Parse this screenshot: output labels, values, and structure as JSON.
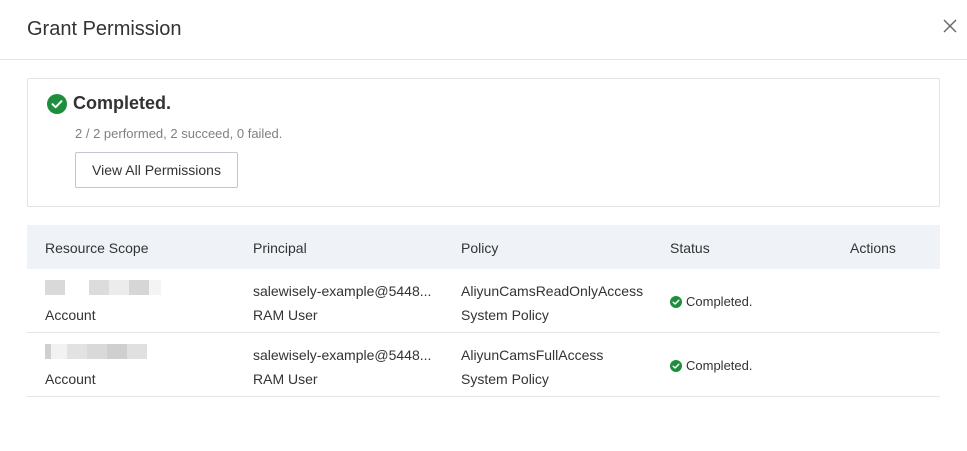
{
  "dialog": {
    "title": "Grant Permission",
    "close_icon": "close-icon"
  },
  "result": {
    "title": "Completed.",
    "summary": "2 / 2 performed, 2 succeed, 0 failed.",
    "view_button": "View All Permissions",
    "icon": "check-circle-icon",
    "color": "#1e8e3e"
  },
  "table": {
    "headers": {
      "scope": "Resource Scope",
      "principal": "Principal",
      "policy": "Policy",
      "status": "Status",
      "actions": "Actions"
    },
    "rows": [
      {
        "scope_type": "Account",
        "principal_name": "salewisely-example@5448...",
        "principal_type": "RAM User",
        "policy_name": "AliyunCamsReadOnlyAccess",
        "policy_type": "System Policy",
        "status": "Completed."
      },
      {
        "scope_type": "Account",
        "principal_name": "salewisely-example@5448...",
        "principal_type": "RAM User",
        "policy_name": "AliyunCamsFullAccess",
        "policy_type": "System Policy",
        "status": "Completed."
      }
    ]
  }
}
